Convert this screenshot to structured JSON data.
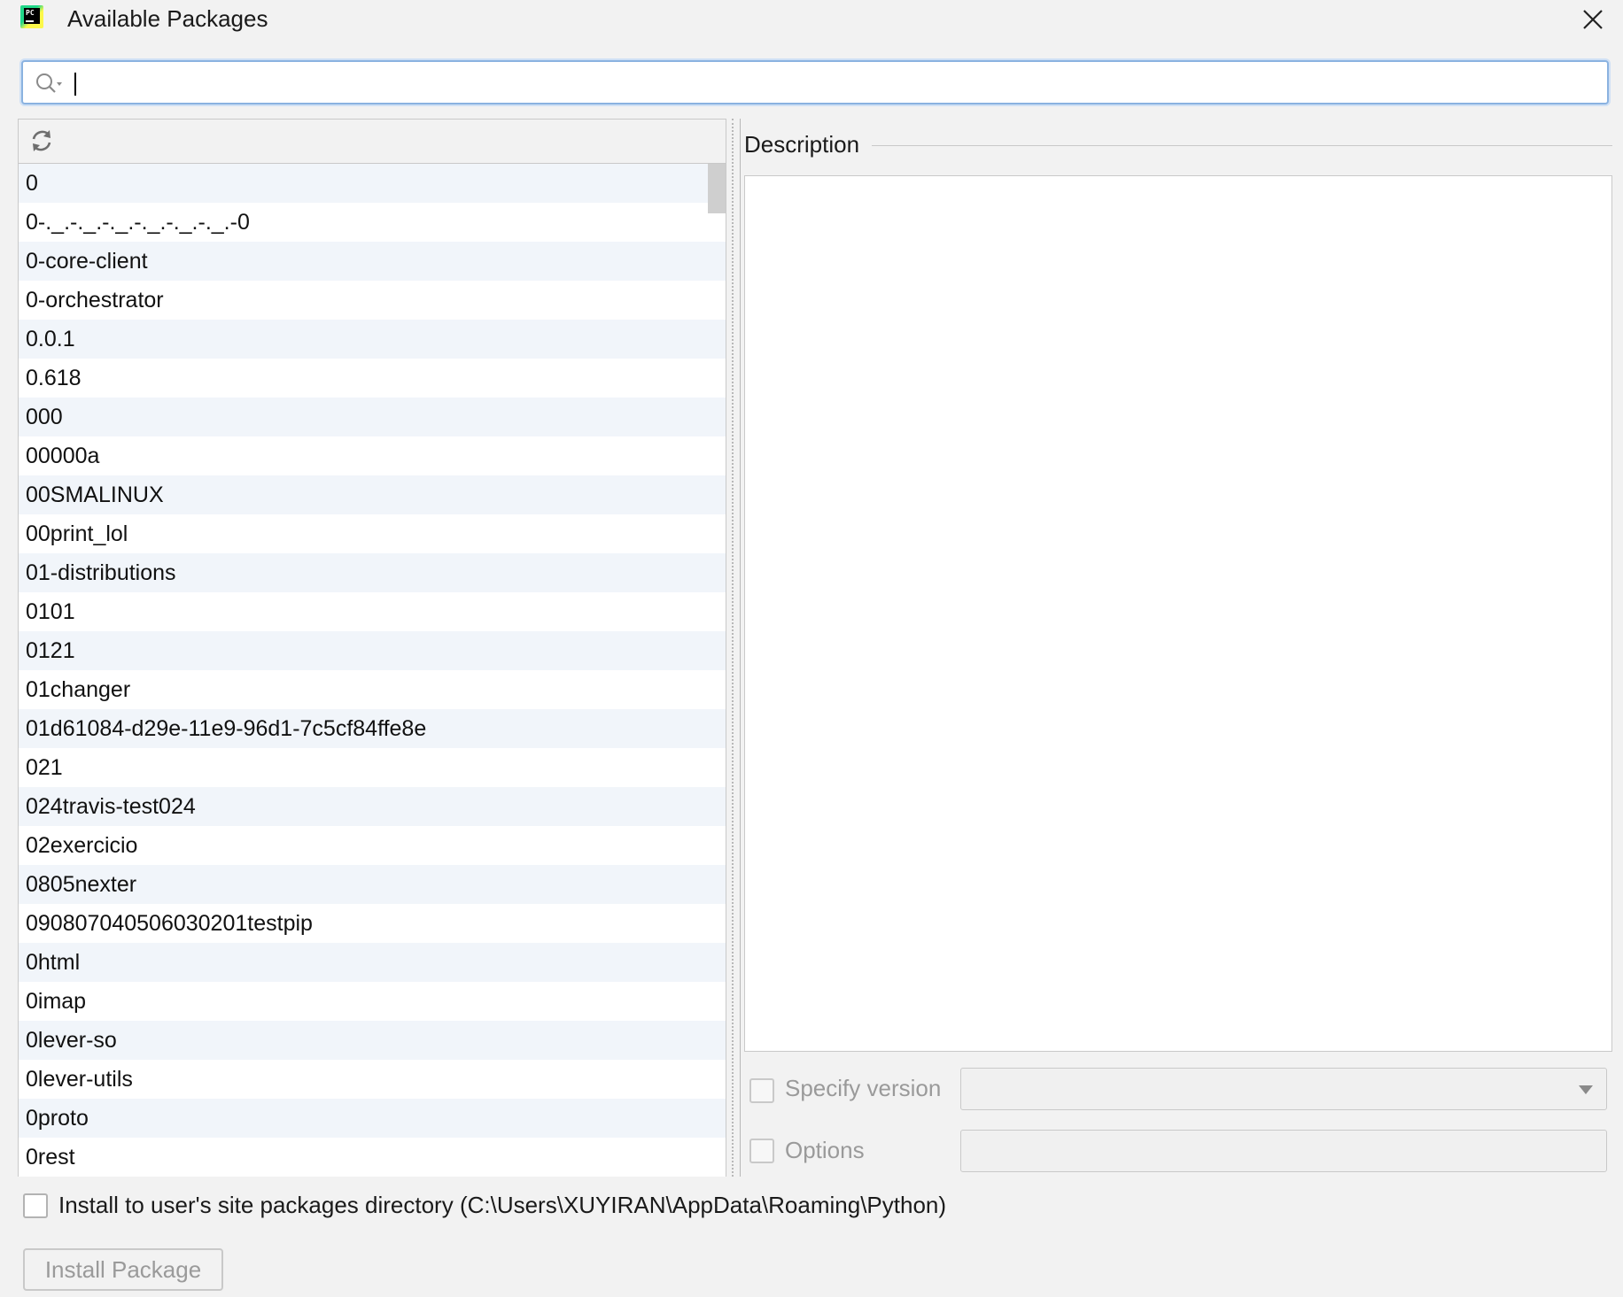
{
  "window": {
    "title": "Available Packages",
    "app_icon": "pycharm-icon",
    "close_icon": "close-icon"
  },
  "search": {
    "value": "",
    "placeholder": "",
    "icon": "search-icon"
  },
  "list": {
    "refresh_icon": "refresh-icon",
    "packages": [
      "0",
      "0-._.-._.-._.-._.-._.-._.-0",
      "0-core-client",
      "0-orchestrator",
      "0.0.1",
      "0.618",
      "000",
      "00000a",
      "00SMALINUX",
      "00print_lol",
      "01-distributions",
      "0101",
      "0121",
      "01changer",
      "01d61084-d29e-11e9-96d1-7c5cf84ffe8e",
      "021",
      "024travis-test024",
      "02exercicio",
      "0805nexter",
      "090807040506030201testpip",
      "0html",
      "0imap",
      "0lever-so",
      "0lever-utils",
      "0proto",
      "0rest"
    ]
  },
  "description": {
    "label": "Description",
    "text": ""
  },
  "options": {
    "specify_version_label": "Specify version",
    "specify_version_checked": false,
    "version_value": "",
    "options_label": "Options",
    "options_checked": false,
    "options_value": ""
  },
  "install_user": {
    "label": "Install to user's site packages directory (C:\\Users\\XUYIRAN\\AppData\\Roaming\\Python)",
    "checked": false
  },
  "install_button": {
    "label": "Install Package"
  }
}
